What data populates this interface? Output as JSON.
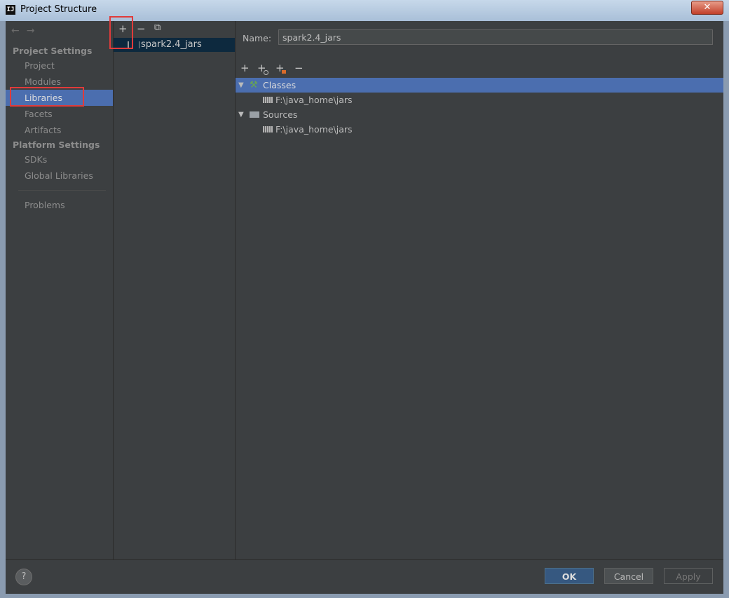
{
  "window": {
    "title": "Project Structure",
    "close_label": "✕"
  },
  "nav": {
    "back": "←",
    "forward": "→"
  },
  "sidebar": {
    "project_settings_header": "Project Settings",
    "project_items": [
      "Project",
      "Modules",
      "Libraries",
      "Facets",
      "Artifacts"
    ],
    "platform_settings_header": "Platform Settings",
    "platform_items": [
      "SDKs",
      "Global Libraries"
    ],
    "problems": "Problems",
    "selected": "Libraries"
  },
  "libraries": {
    "toolbar": {
      "add": "+",
      "remove": "−",
      "copy": "⧉"
    },
    "items": [
      "spark2.4_jars"
    ]
  },
  "detail": {
    "name_label": "Name:",
    "name_value": "spark2.4_jars",
    "toolbar": {
      "add": "+",
      "add_alt": "+",
      "add_jar": "+",
      "remove": "−"
    },
    "tree": {
      "classes": "Classes",
      "classes_path": "F:\\java_home\\jars",
      "sources": "Sources",
      "sources_path": "F:\\java_home\\jars"
    }
  },
  "footer": {
    "help": "?",
    "ok": "OK",
    "cancel": "Cancel",
    "apply": "Apply"
  },
  "colors": {
    "selection": "#4b6eaf",
    "background": "#3c3f41",
    "highlight_box": "#e03b3b",
    "ok_button": "#365880"
  }
}
